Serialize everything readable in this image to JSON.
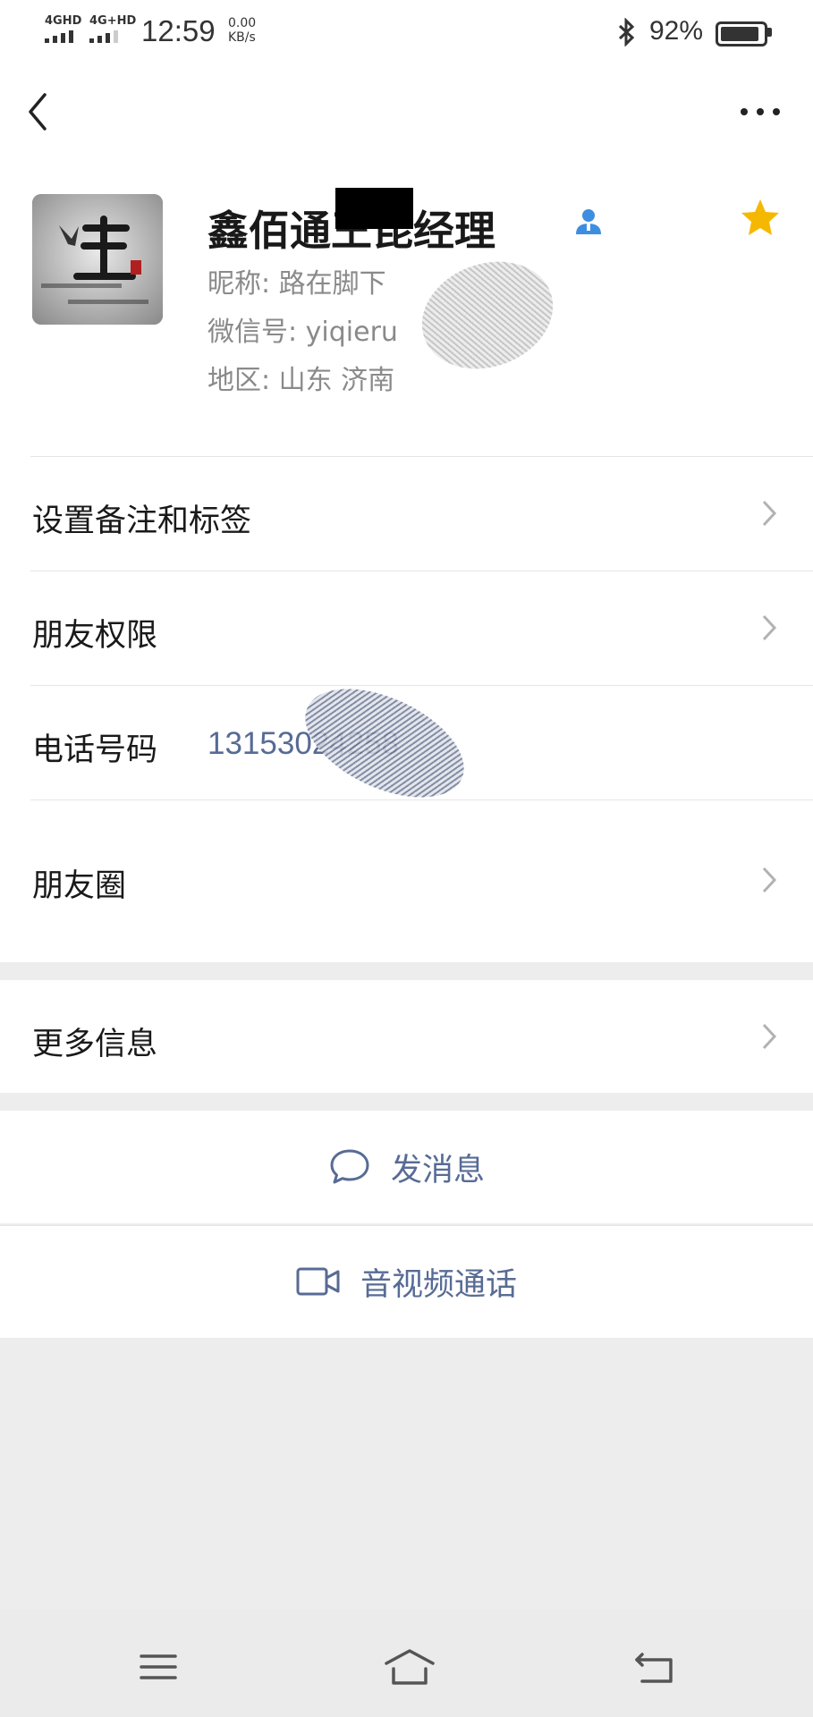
{
  "status_bar": {
    "signal_1": "4GHD",
    "signal_2": "4G+HD",
    "time": "12:59",
    "speed_value": "0.00",
    "speed_unit": "KB/s",
    "bluetooth_icon": "bluetooth-icon",
    "battery_percent": "92%",
    "battery_level": 0.92
  },
  "nav": {
    "back_icon": "chevron-left-icon",
    "more_icon": "more-dots-icon"
  },
  "profile": {
    "name": "鑫佰通王",
    "name_suffix": "昆经理",
    "nickname": "昵称: 路在脚下",
    "wechat_id": "微信号: yiqieru",
    "region": "地区: 山东  济南",
    "contact_icon": "contact-person-icon",
    "star_icon": "star-icon",
    "star_color": "#f5b800"
  },
  "rows": [
    {
      "label": "设置备注和标签"
    },
    {
      "label": "朋友权限"
    },
    {
      "label": "电话号码",
      "value": "13153024258"
    },
    {
      "label": "朋友圈"
    },
    {
      "label": "更多信息"
    }
  ],
  "actions": {
    "message_label": "发消息",
    "message_icon": "chat-bubble-icon",
    "call_label": "音视频通话",
    "call_icon": "video-camera-icon"
  },
  "system_nav": {
    "menu_icon": "menu-icon",
    "home_icon": "home-icon",
    "back_icon": "back-arrow-icon"
  },
  "colors": {
    "link": "#576b95",
    "background": "#ededed"
  }
}
